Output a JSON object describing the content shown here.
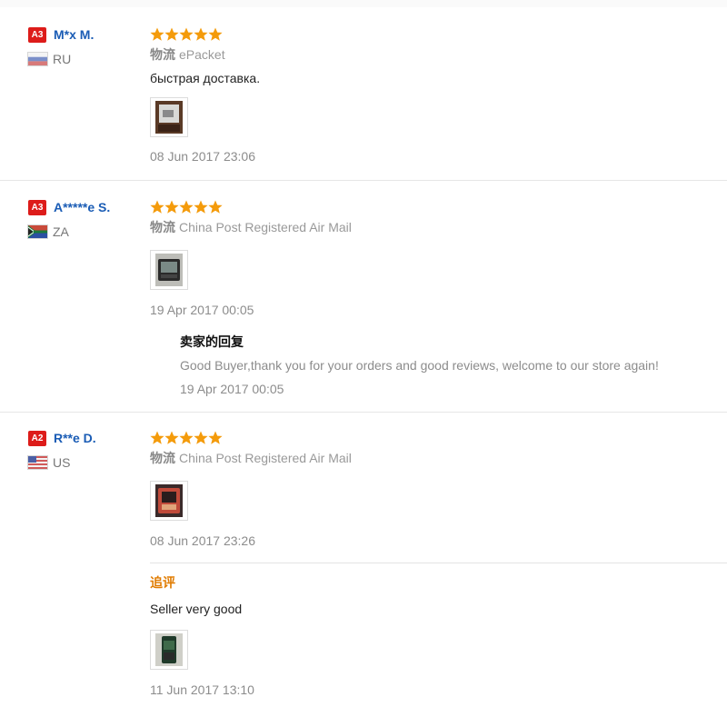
{
  "colors": {
    "accent": "#1a5cb5",
    "star": "#f49b0b",
    "badge": "#dd1c1a",
    "additional": "#e07b00"
  },
  "reviews": [
    {
      "level": "A3",
      "name": "M*x M.",
      "country": "RU",
      "flag": "ru-flag-icon",
      "rating": 5,
      "logistics_label": "物流",
      "logistics": "ePacket",
      "text": "быстрая доставка.",
      "date": "08 Jun 2017 23:06"
    },
    {
      "level": "A3",
      "name": "A*****e S.",
      "country": "ZA",
      "flag": "za-flag-icon",
      "rating": 5,
      "logistics_label": "物流",
      "logistics": "China Post Registered Air Mail",
      "date": "19 Apr 2017 00:05",
      "reply": {
        "title": "卖家的回复",
        "text": "Good Buyer,thank you for your orders and good reviews, welcome to our store again!",
        "date": "19 Apr 2017 00:05"
      }
    },
    {
      "level": "A2",
      "name": "R**e D.",
      "country": "US",
      "flag": "us-flag-icon",
      "rating": 5,
      "logistics_label": "物流",
      "logistics": "China Post Registered Air Mail",
      "date": "08 Jun 2017 23:26",
      "additional": {
        "title": "追评",
        "text": "Seller very good",
        "date": "11 Jun 2017 13:10"
      }
    }
  ]
}
